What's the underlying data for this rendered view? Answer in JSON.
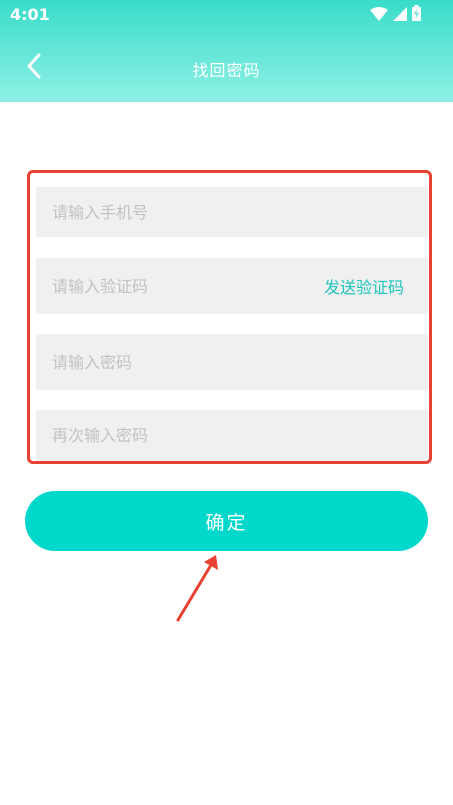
{
  "status_bar": {
    "time": "4:01",
    "icons": [
      "wifi-icon",
      "signal-icon",
      "battery-charging-icon"
    ]
  },
  "navbar": {
    "back_icon": "chevron-left-icon",
    "title": "找回密码"
  },
  "form": {
    "phone_placeholder": "请输入手机号",
    "code_placeholder": "请输入验证码",
    "send_code_label": "发送验证码",
    "password_placeholder": "请输入密码",
    "confirm_password_placeholder": "再次输入密码"
  },
  "confirm_button": {
    "label": "确定"
  },
  "colors": {
    "header_gradient_top": "#39dcc9",
    "header_gradient_bottom": "#8ff0e5",
    "accent": "#00d8cc",
    "send_code_text": "#1fc6bd",
    "annotation_red": "#e84132",
    "field_background": "#f0f0f0"
  }
}
